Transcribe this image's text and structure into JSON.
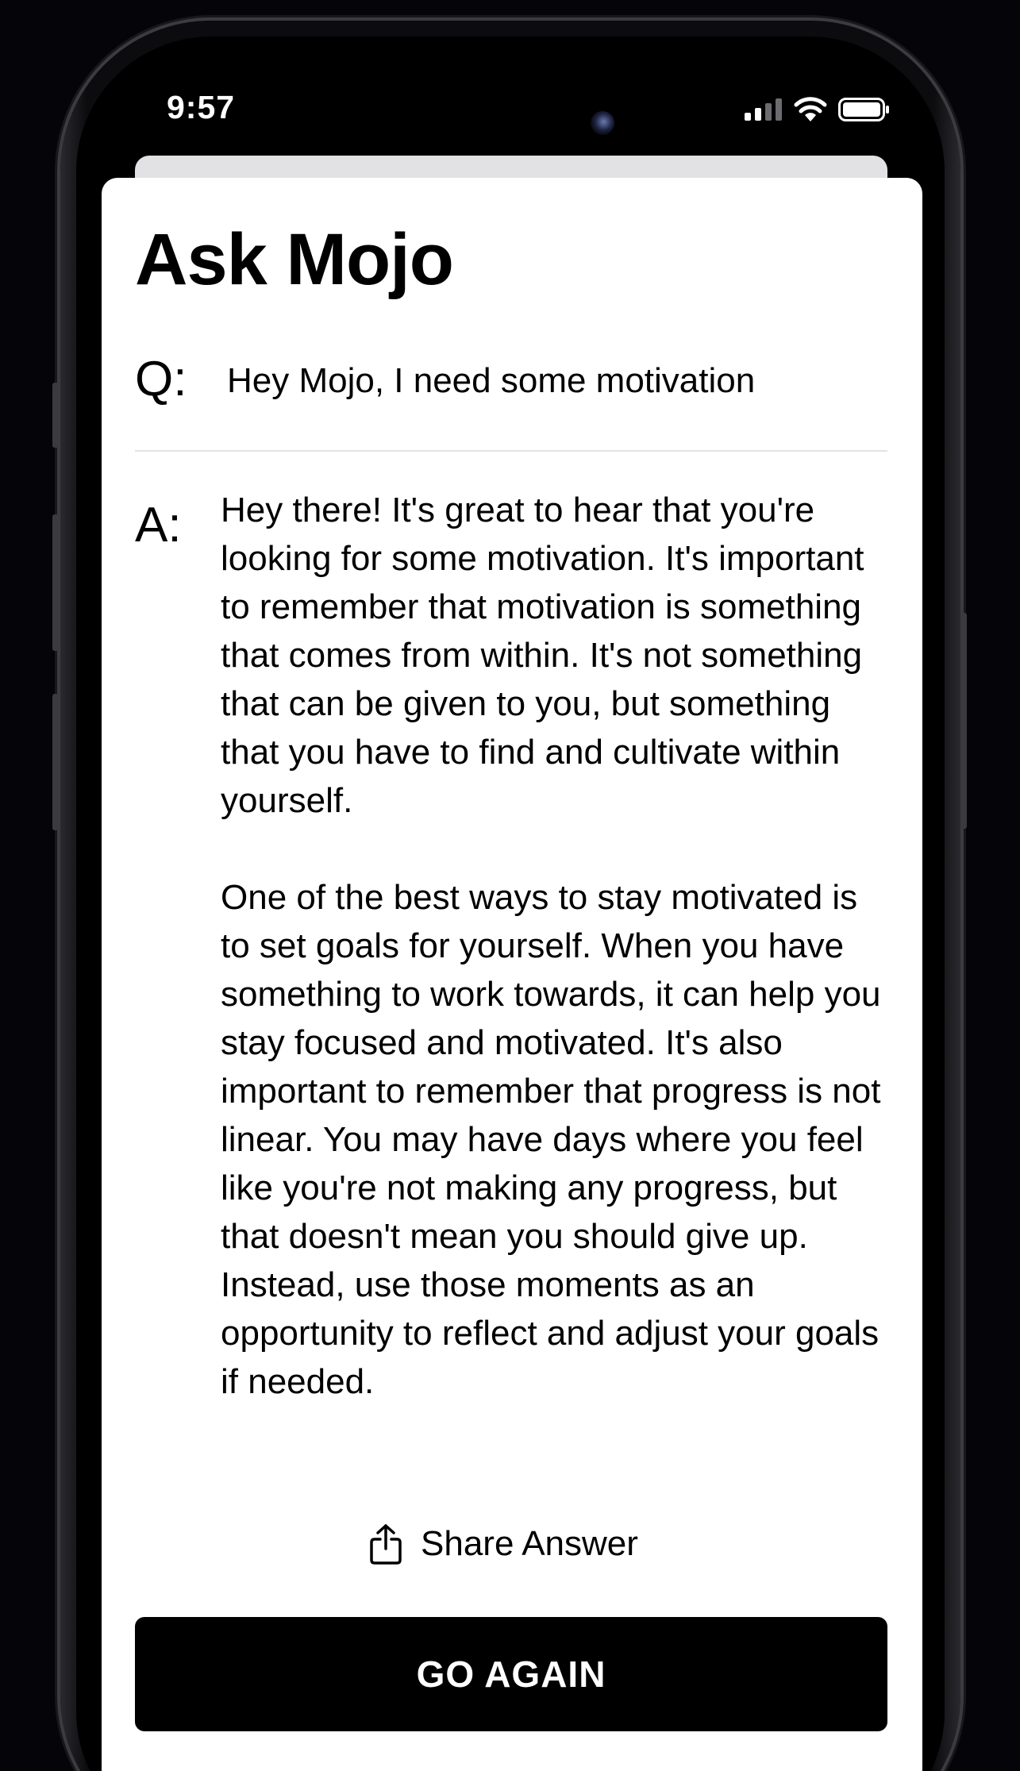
{
  "status_bar": {
    "time": "9:57",
    "icons": [
      "cellular-signal-icon",
      "wifi-icon",
      "battery-icon"
    ]
  },
  "page": {
    "title": "Ask Mojo"
  },
  "question": {
    "prefix": "Q:",
    "text": "Hey Mojo, I need some motivation"
  },
  "answer": {
    "prefix": "A:",
    "paragraphs": [
      "Hey there! It's great to hear that you're looking for some motivation. It's important to remember that motivation is something that comes from within. It's not something that can be given to you, but something that you have to find and cultivate within yourself.",
      "One of the best ways to stay motivated is to set goals for yourself. When you have something to work towards, it can help you stay focused and motivated. It's also important to remember that progress is not linear. You may have days where you feel like you're not making any progress, but that doesn't mean you should give up. Instead, use those moments as an opportunity to reflect and adjust your goals if needed."
    ]
  },
  "actions": {
    "share_label": "Share Answer",
    "share_icon": "share-icon",
    "go_again_label": "GO AGAIN"
  },
  "colors": {
    "background": "#050509",
    "card": "#ffffff",
    "text": "#000000",
    "button": "#000000",
    "button_text": "#ffffff",
    "divider": "#e3e3e5"
  }
}
